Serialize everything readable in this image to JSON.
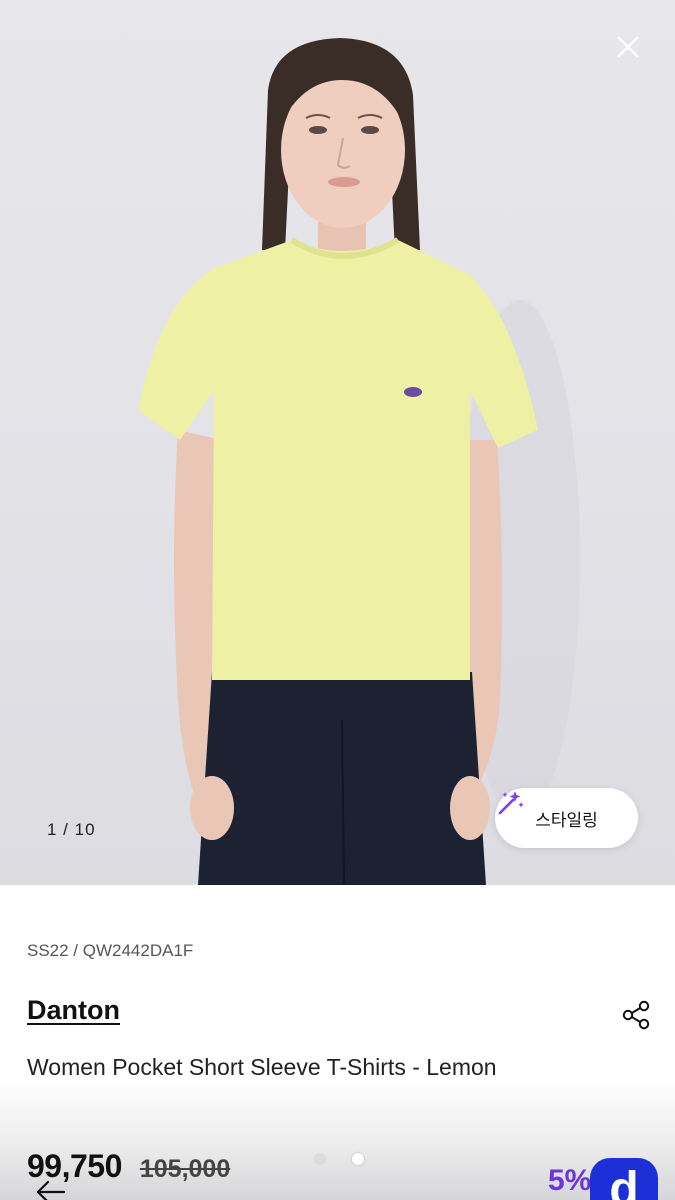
{
  "gallery": {
    "counter": "1 / 10",
    "current_index": 1,
    "total": 10,
    "styling_label": "스타일링",
    "dots_total": 2,
    "dots_active": 2
  },
  "product": {
    "sku": "SS22 / QW2442DA1F",
    "brand": "Danton",
    "title": "Women Pocket Short Sleeve T-Shirts - Lemon",
    "price": "99,750",
    "original_price": "105,000",
    "discount": "5%"
  },
  "app": {
    "logo_letter": "d"
  },
  "icons": {
    "close": "close-icon",
    "share": "share-icon",
    "back": "arrow-left-icon",
    "styling": "magic-wand-icon"
  },
  "colors": {
    "shirt": "#eef0a3",
    "pants": "#1d2233",
    "discount": "#6a35d9",
    "app_logo": "#1d2fd6",
    "styling_icon": "#7b3fe4"
  }
}
